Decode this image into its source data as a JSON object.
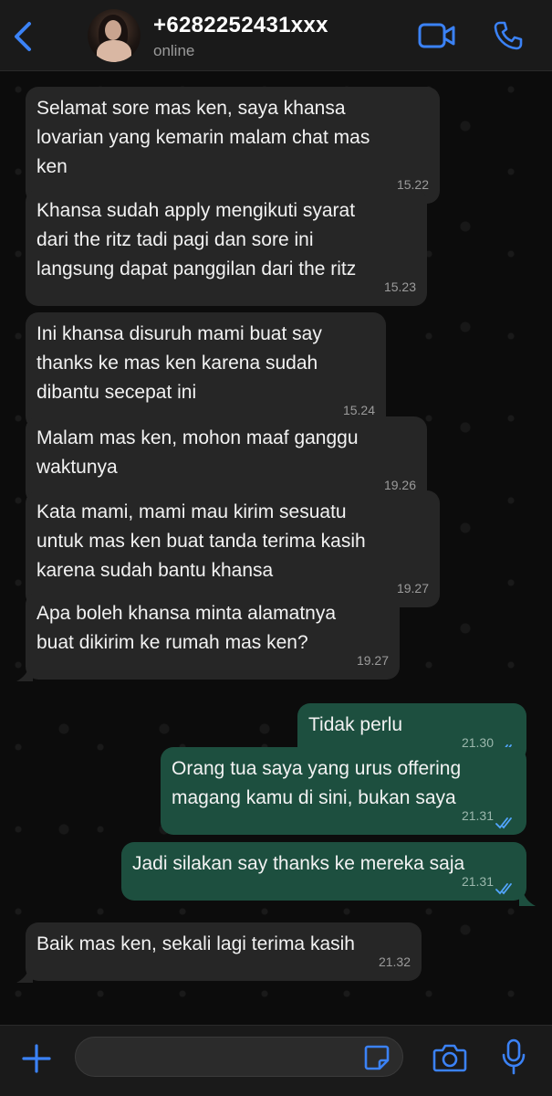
{
  "header": {
    "contact_name": "+6282252431xxx",
    "status": "online",
    "accent_color": "#3b82f6"
  },
  "messages": [
    {
      "direction": "in",
      "text": "Selamat sore mas ken, saya khansa\nlovarian yang kemarin malam chat mas\nken",
      "time": "15.22"
    },
    {
      "direction": "in",
      "text": "Khansa sudah apply mengikuti syarat\ndari the ritz tadi pagi dan sore ini\nlangsung dapat panggilan dari the ritz",
      "time": "15.23"
    },
    {
      "direction": "in",
      "text": "Ini khansa disuruh mami buat say\nthanks ke mas ken karena sudah\ndibantu secepat ini",
      "time": "15.24"
    },
    {
      "direction": "in",
      "text": "Malam mas ken, mohon maaf ganggu\nwaktunya",
      "time": "19.26"
    },
    {
      "direction": "in",
      "text": "Kata mami, mami mau kirim sesuatu\nuntuk mas ken buat tanda terima kasih\nkarena sudah bantu khansa",
      "time": "19.27"
    },
    {
      "direction": "in",
      "text": "Apa boleh khansa minta alamatnya\nbuat dikirim ke rumah mas ken?",
      "time": "19.27"
    },
    {
      "direction": "out",
      "text": "Tidak perlu",
      "time": "21.30"
    },
    {
      "direction": "out",
      "text": "Orang tua saya yang urus offering\nmagang kamu di sini, bukan saya",
      "time": "21.31"
    },
    {
      "direction": "out",
      "text": "Jadi silakan say thanks ke mereka saja",
      "time": "21.31"
    },
    {
      "direction": "in",
      "text": "Baik mas ken, sekali lagi terima kasih",
      "time": "21.32"
    }
  ],
  "composer": {
    "value": "",
    "placeholder": ""
  },
  "icons": {
    "back": "chevron-left-icon",
    "video": "video-camera-icon",
    "call": "phone-icon",
    "plus": "plus-icon",
    "sticker": "sticker-icon",
    "camera": "camera-icon",
    "mic": "microphone-icon"
  }
}
